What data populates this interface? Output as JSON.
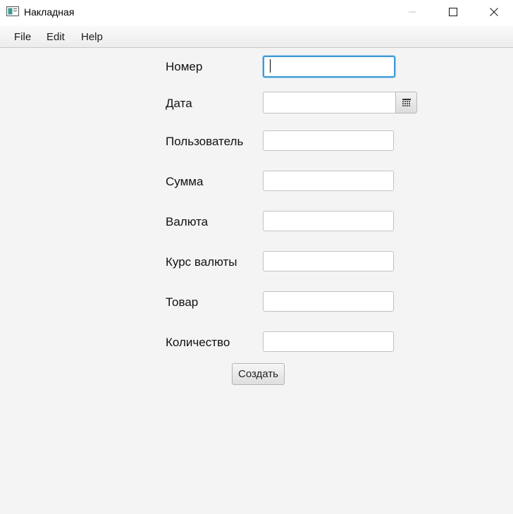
{
  "window": {
    "title": "Накладная",
    "accent_color": "#3c9bd6"
  },
  "menu": {
    "items": [
      "File",
      "Edit",
      "Help"
    ]
  },
  "form": {
    "fields": [
      {
        "label": "Номер",
        "value": ""
      },
      {
        "label": "Дата",
        "value": ""
      },
      {
        "label": "Пользователь",
        "value": ""
      },
      {
        "label": "Сумма",
        "value": ""
      },
      {
        "label": "Валюта",
        "value": ""
      },
      {
        "label": "Курс валюты",
        "value": ""
      },
      {
        "label": "Товар",
        "value": ""
      },
      {
        "label": "Количество",
        "value": ""
      }
    ],
    "submit_label": "Создать"
  }
}
